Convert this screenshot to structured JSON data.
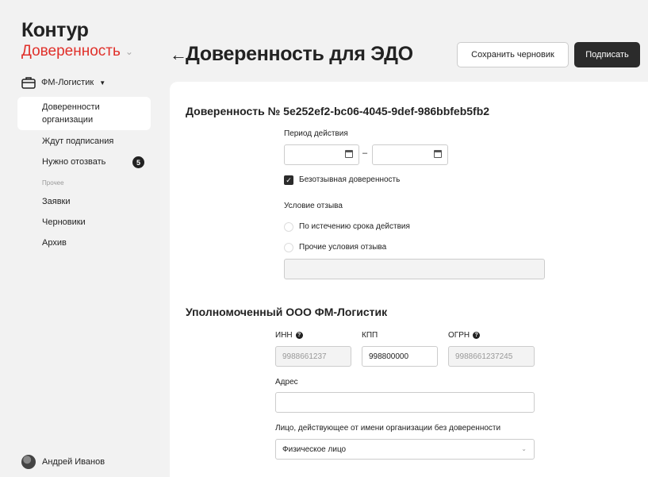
{
  "sidebar": {
    "brand": "Контур",
    "product": "Доверенность",
    "org": "ФМ-Логистик",
    "items": [
      {
        "label": "Доверенности организации"
      },
      {
        "label": "Ждут подписания"
      },
      {
        "label": "Нужно отозвать",
        "count": "5"
      }
    ],
    "other_section": "Прочее",
    "other_items": [
      {
        "label": "Заявки"
      },
      {
        "label": "Черновики"
      },
      {
        "label": "Архив"
      }
    ],
    "user": "Андрей Иванов"
  },
  "header": {
    "title": "Доверенность для ЭДО",
    "save_draft_label": "Сохранить черновик",
    "sign_label": "Подписать"
  },
  "form": {
    "doc_number": "Доверенность № 5e252ef2-bc06-4045-9def-986bbfeb5fb2",
    "period_label": "Период действия",
    "period_dash": "–",
    "irrevocable_label": "Безотзывная доверенность",
    "revocation_label": "Условие отзыва",
    "revocation_options": [
      {
        "label": "По истечению срока действия"
      },
      {
        "label": "Прочие условия отзыва"
      }
    ],
    "authorized_title": "Уполномоченный ООО ФМ-Логистик",
    "inn_label": "ИНН",
    "inn_value": "9988661237",
    "kpp_label": "КПП",
    "kpp_value": "998800000",
    "ogrn_label": "ОГРН",
    "ogrn_value": "9988661237245",
    "address_label": "Адрес",
    "address_value": "",
    "person_label": "Лицо, действующее от имени организации без доверенности",
    "person_value": "Физическое лицо"
  },
  "colors": {
    "accent": "#e0302a",
    "primary_button": "#2b2b2b"
  }
}
